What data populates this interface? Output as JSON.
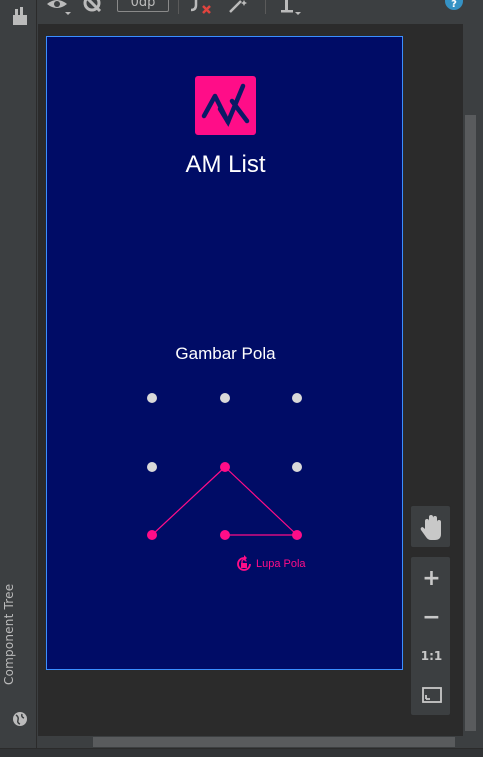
{
  "toolbar": {
    "margin_value": "0dp",
    "icons": [
      "eye-icon",
      "eye-off-icon",
      "clear-constraints-icon",
      "magic-wand-icon",
      "align-icon",
      "help-icon"
    ]
  },
  "left_strip": {
    "component_tree_label": "Component Tree",
    "icons": [
      "palette-icon",
      "globe-icon"
    ]
  },
  "app": {
    "title": "AM List",
    "pattern_title": "Gambar Pola",
    "forgot_label": "Lupa Pola"
  },
  "pattern": {
    "dots": 9,
    "selected_sequence": [
      7,
      5,
      9,
      8
    ],
    "colors": {
      "idle": "#d9d9d9",
      "active": "#ff0d88",
      "line": "#ff0d88"
    }
  },
  "zoom_controls": {
    "plus": "+",
    "minus": "−",
    "actual_size": "1:1",
    "icons": [
      "pan-hand-icon",
      "fit-screen-icon"
    ]
  },
  "colors": {
    "screen_bg": "#000c66",
    "accent": "#ff0d88",
    "ide_bg": "#3c3f41",
    "canvas_bg": "#2b2b2b",
    "selection_border": "#3b8fff"
  }
}
